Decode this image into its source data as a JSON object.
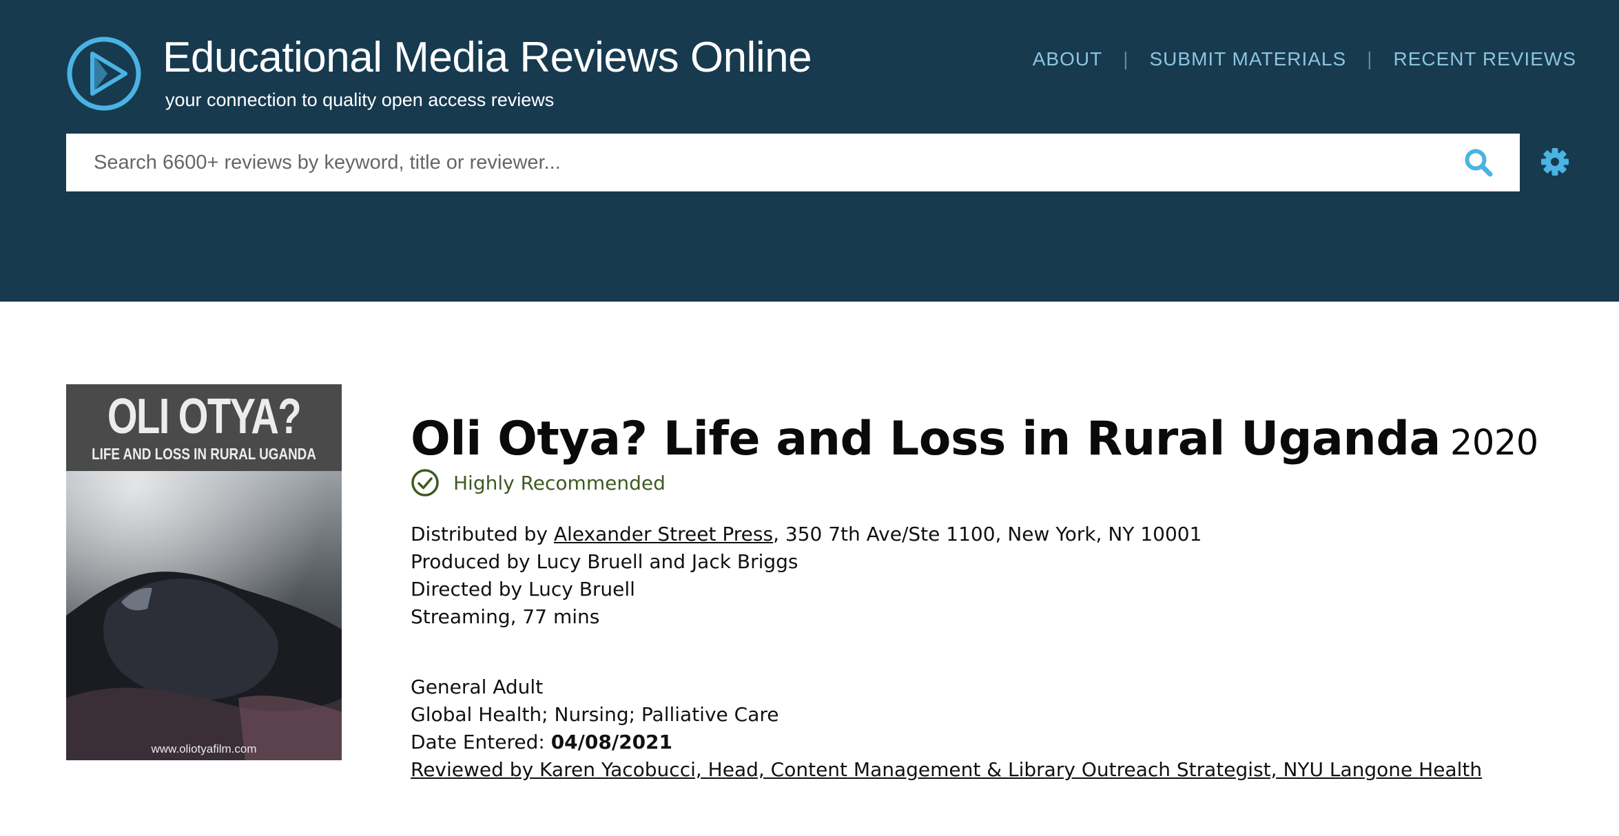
{
  "header": {
    "site_title": "Educational Media Reviews Online",
    "tagline": "your connection to quality open access reviews",
    "nav": [
      {
        "label": "ABOUT"
      },
      {
        "label": "SUBMIT MATERIALS"
      },
      {
        "label": "RECENT REVIEWS"
      }
    ],
    "nav_separator": "|",
    "search": {
      "placeholder": "Search 6600+ reviews by keyword, title or reviewer...",
      "value": ""
    },
    "colors": {
      "background": "#173a4f",
      "accent": "#4ab3e3",
      "nav_text": "#8cc4e0"
    }
  },
  "cover": {
    "title": "OLI OTYA?",
    "subtitle": "LIFE AND LOSS IN RURAL UGANDA",
    "url": "www.oliotyafilm.com"
  },
  "review": {
    "title": "Oli Otya? Life and Loss in Rural Uganda",
    "year": "2020",
    "recommendation": "Highly Recommended",
    "recommendation_color": "#3d5a22",
    "distributed_prefix": "Distributed by ",
    "distributor": "Alexander Street Press",
    "distributor_address": ", 350 7th Ave/Ste 1100, New York, NY 10001",
    "produced_by": "Produced by Lucy Bruell and Jack Briggs",
    "directed_by": "Directed by Lucy Bruell",
    "format": "Streaming, 77 mins",
    "audience": "General Adult",
    "subjects": "Global Health; Nursing; Palliative Care",
    "date_label": "Date Entered: ",
    "date_entered": "04/08/2021",
    "reviewed_by": "Reviewed by Karen Yacobucci, Head, Content Management & Library Outreach Strategist, NYU Langone Health"
  }
}
